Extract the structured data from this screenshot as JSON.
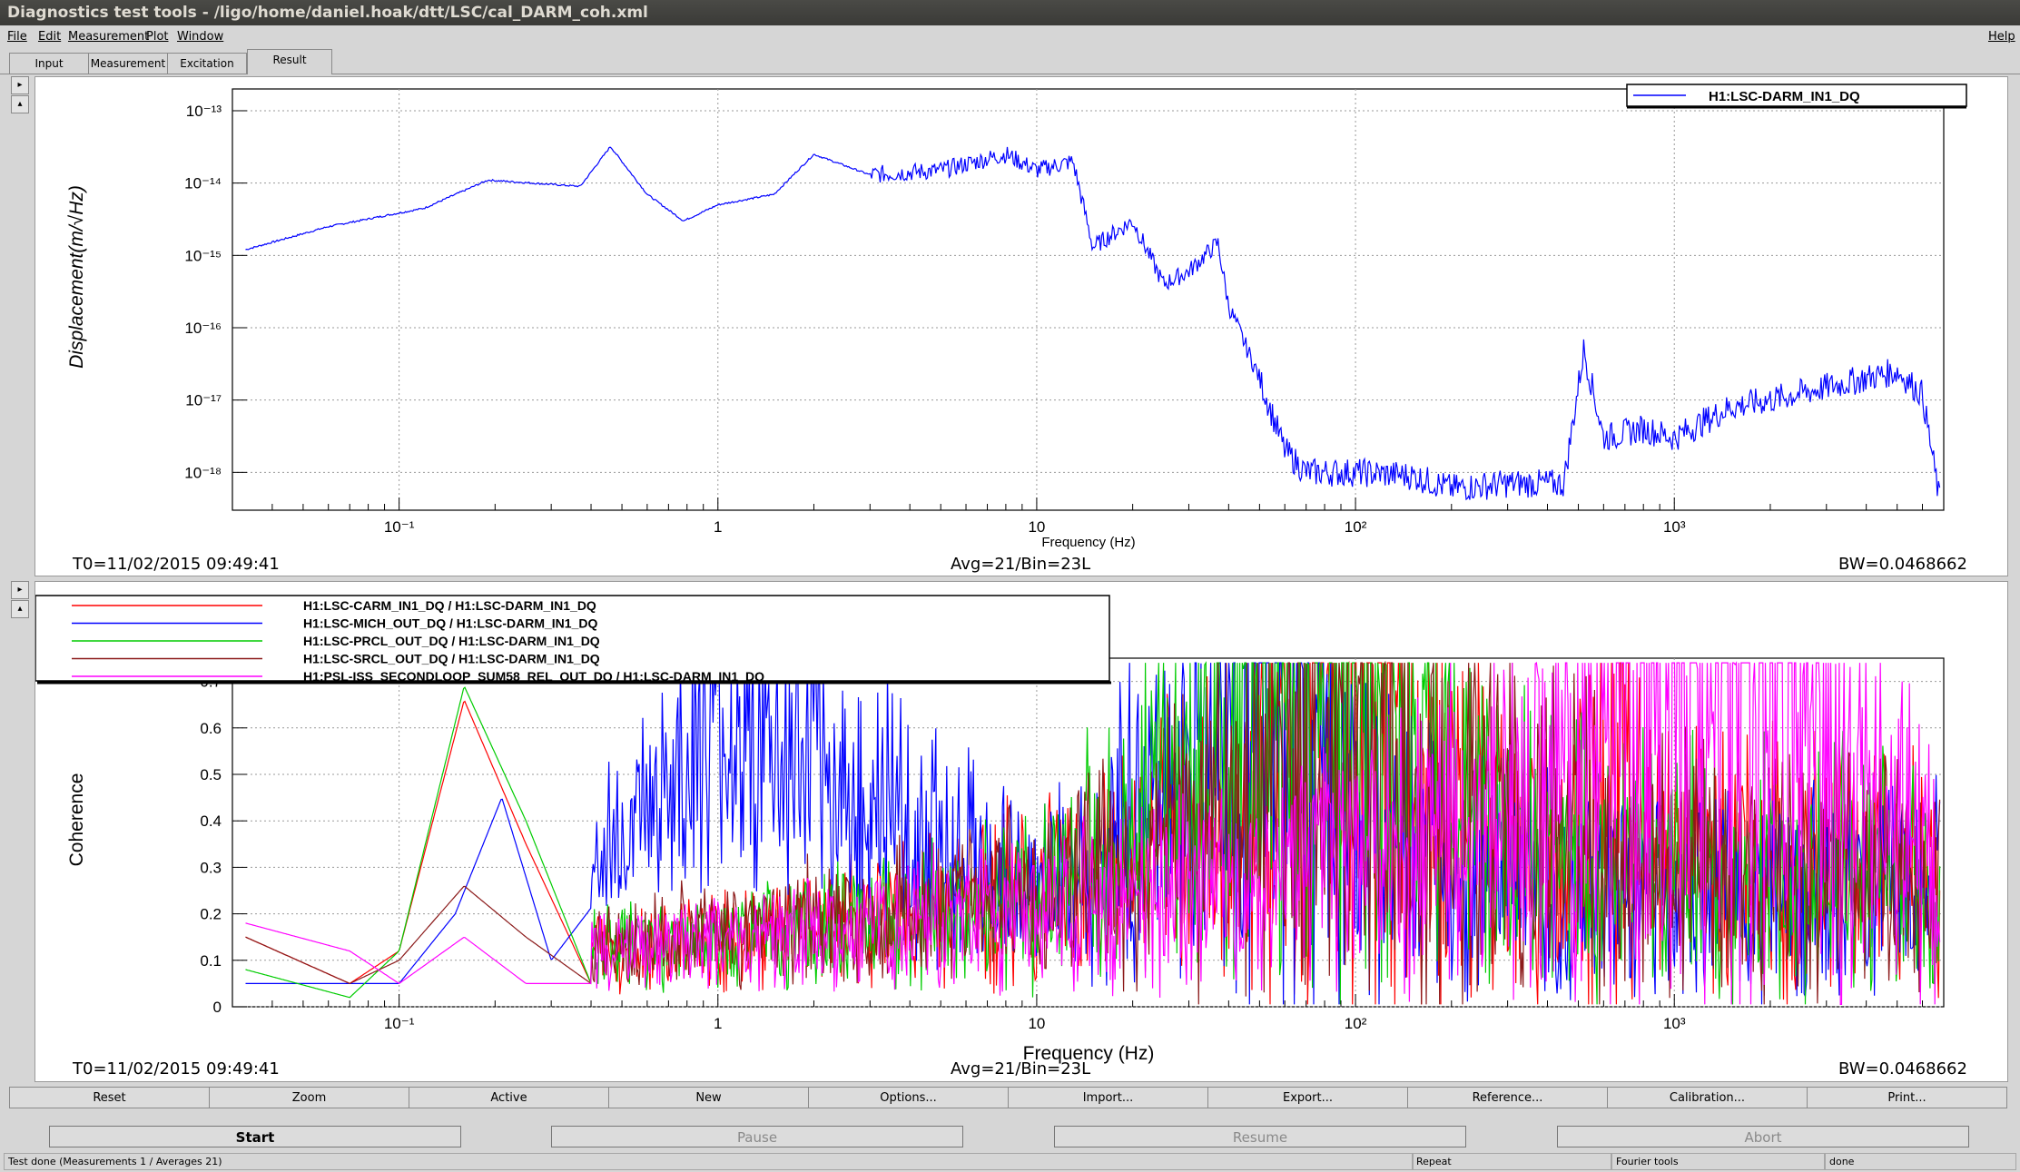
{
  "window": {
    "title": "Diagnostics test tools - /ligo/home/daniel.hoak/dtt/LSC/cal_DARM_coh.xml"
  },
  "menu": [
    "File",
    "Edit",
    "Measurement",
    "Plot",
    "Window"
  ],
  "menu_help": "Help",
  "tabs": [
    "Input",
    "Measurement",
    "Excitation",
    "Result"
  ],
  "active_tab": "Result",
  "top_plot": {
    "ylabel": "Displacement(m/√Hz)",
    "xlabel": "Frequency (Hz)",
    "legend": "H1:LSC-DARM_IN1_DQ",
    "x_ticks": [
      "10⁻¹",
      "1",
      "10",
      "10²",
      "10³"
    ],
    "y_ticks": [
      "10⁻¹³",
      "10⁻¹⁴",
      "10⁻¹⁵",
      "10⁻¹⁶",
      "10⁻¹⁷",
      "10⁻¹⁸"
    ],
    "t0": "T0=11/02/2015 09:49:41",
    "avg": "Avg=21/Bin=23L",
    "bw": "BW=0.0468662"
  },
  "bottom_plot": {
    "ylabel": "Coherence",
    "xlabel": "Frequency (Hz)",
    "x_ticks": [
      "10⁻¹",
      "1",
      "10",
      "10²",
      "10³"
    ],
    "y_ticks": [
      "0.7",
      "0.6",
      "0.5",
      "0.4",
      "0.3",
      "0.2",
      "0.1",
      "0"
    ],
    "legend": [
      "H1:LSC-CARM_IN1_DQ / H1:LSC-DARM_IN1_DQ",
      "H1:LSC-MICH_OUT_DQ / H1:LSC-DARM_IN1_DQ",
      "H1:LSC-PRCL_OUT_DQ / H1:LSC-DARM_IN1_DQ",
      "H1:LSC-SRCL_OUT_DQ / H1:LSC-DARM_IN1_DQ",
      "H1:PSL-ISS_SECONDLOOP_SUM58_REL_OUT_DQ / H1:LSC-DARM_IN1_DQ"
    ],
    "t0": "T0=11/02/2015 09:49:41",
    "avg": "Avg=21/Bin=23L",
    "bw": "BW=0.0468662"
  },
  "colors": {
    "darm": "#0000ff",
    "carm": "#ff0000",
    "mich": "#0000ff",
    "prcl": "#00cc00",
    "srcl": "#8b1a1a",
    "psl": "#ff00ff"
  },
  "buttons": [
    "Reset",
    "Zoom",
    "Active",
    "New",
    "Options...",
    "Import...",
    "Export...",
    "Reference...",
    "Calibration...",
    "Print..."
  ],
  "actions": [
    "Start",
    "Pause",
    "Resume",
    "Abort"
  ],
  "status": [
    "Test done (Measurements 1 / Averages 21)",
    "Repeat",
    "Fourier tools",
    "done"
  ],
  "chart_data": [
    {
      "type": "line",
      "title": "",
      "xlabel": "Frequency (Hz)",
      "ylabel": "Displacement(m/√Hz)",
      "xscale": "log",
      "yscale": "log",
      "xlim": [
        0.03,
        7000
      ],
      "ylim": [
        3e-19,
        2e-13
      ],
      "grid": true,
      "legend_position": "top-right",
      "series": [
        {
          "name": "H1:LSC-DARM_IN1_DQ",
          "color": "#0000ff",
          "x": [
            0.033,
            0.06,
            0.12,
            0.19,
            0.37,
            0.46,
            0.6,
            0.78,
            1.0,
            1.5,
            2.0,
            3.0,
            5.0,
            8.0,
            10,
            13,
            15,
            20,
            25,
            30,
            37,
            40,
            50,
            60,
            70,
            100,
            150,
            200,
            300,
            450,
            520,
            600,
            800,
            1000,
            1500,
            2000,
            3000,
            4000,
            5000,
            6000,
            6800
          ],
          "y": [
            1.2e-15,
            2.5e-15,
            4.5e-15,
            1.1e-14,
            9e-15,
            3.2e-14,
            7e-15,
            3e-15,
            5e-15,
            7e-15,
            2.5e-14,
            1.3e-14,
            1.5e-14,
            2.5e-14,
            1.5e-14,
            2e-14,
            1.3e-15,
            3e-15,
            4e-16,
            6e-16,
            1.5e-15,
            2e-16,
            2e-17,
            2e-18,
            1e-18,
            1e-18,
            9e-19,
            6e-19,
            7e-19,
            7e-19,
            5e-17,
            3e-18,
            4e-18,
            3e-18,
            8e-18,
            1e-17,
            1.5e-17,
            2e-17,
            2.5e-17,
            1.2e-17,
            4e-19
          ]
        }
      ]
    },
    {
      "type": "line",
      "title": "",
      "xlabel": "Frequency (Hz)",
      "ylabel": "Coherence",
      "xscale": "log",
      "xlim": [
        0.03,
        7000
      ],
      "ylim": [
        0,
        0.75
      ],
      "grid": true,
      "legend_position": "top-left",
      "series": [
        {
          "name": "H1:LSC-CARM_IN1_DQ / H1:LSC-DARM_IN1_DQ",
          "color": "#ff0000",
          "x": [
            0.033,
            0.07,
            0.1,
            0.16,
            0.25,
            0.4,
            1,
            3,
            10,
            40,
            60,
            100,
            150,
            200,
            300,
            500,
            700,
            1000,
            3000,
            6800
          ],
          "y": [
            0.15,
            0.05,
            0.12,
            0.66,
            0.35,
            0.05,
            0.05,
            0.08,
            0.12,
            0.2,
            0.3,
            0.45,
            0.35,
            0.2,
            0.12,
            0.15,
            0.25,
            0.1,
            0.12,
            0.08
          ]
        },
        {
          "name": "H1:LSC-MICH_OUT_DQ / H1:LSC-DARM_IN1_DQ",
          "color": "#0000ff",
          "x": [
            0.033,
            0.1,
            0.15,
            0.21,
            0.3,
            0.5,
            1,
            2,
            10,
            60,
            100,
            200,
            500,
            1000,
            3000,
            6800
          ],
          "y": [
            0.05,
            0.05,
            0.2,
            0.45,
            0.1,
            0.3,
            0.5,
            0.4,
            0.1,
            0.5,
            0.2,
            0.08,
            0.05,
            0.05,
            0.05,
            0.05
          ]
        },
        {
          "name": "H1:LSC-PRCL_OUT_DQ / H1:LSC-DARM_IN1_DQ",
          "color": "#00cc00",
          "x": [
            0.033,
            0.07,
            0.1,
            0.16,
            0.25,
            0.4,
            1,
            10,
            100,
            300,
            1000,
            6800
          ],
          "y": [
            0.08,
            0.02,
            0.12,
            0.69,
            0.4,
            0.05,
            0.05,
            0.1,
            0.5,
            0.15,
            0.1,
            0.08
          ]
        },
        {
          "name": "H1:LSC-SRCL_OUT_DQ / H1:LSC-DARM_IN1_DQ",
          "color": "#8b1a1a",
          "x": [
            0.033,
            0.07,
            0.1,
            0.16,
            0.25,
            0.4,
            1,
            10,
            100,
            1000,
            6800
          ],
          "y": [
            0.15,
            0.05,
            0.1,
            0.26,
            0.15,
            0.05,
            0.08,
            0.1,
            0.3,
            0.1,
            0.08
          ]
        },
        {
          "name": "H1:PSL-ISS_SECONDLOOP_SUM58_REL_OUT_DQ / H1:LSC-DARM_IN1_DQ",
          "color": "#ff00ff",
          "x": [
            0.033,
            0.07,
            0.1,
            0.16,
            0.25,
            1,
            10,
            100,
            500,
            800,
            1000,
            2000,
            3000,
            6800
          ],
          "y": [
            0.18,
            0.12,
            0.05,
            0.15,
            0.05,
            0.05,
            0.08,
            0.1,
            0.3,
            0.8,
            0.9,
            0.5,
            0.3,
            0.08
          ]
        }
      ]
    }
  ]
}
